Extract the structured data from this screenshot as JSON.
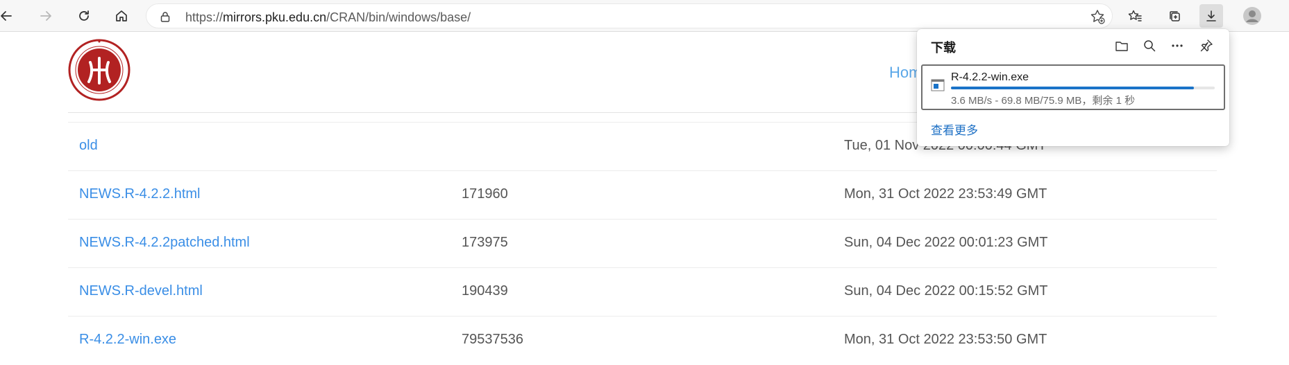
{
  "browser": {
    "url_prefix": "https://",
    "url_host": "mirrors.pku.edu.cn",
    "url_path": "/CRAN/bin/windows/base/"
  },
  "page": {
    "home_link": "Hom",
    "rows": [
      {
        "name": "old",
        "size": "",
        "date": "Tue, 01 Nov 2022 00:00:44 GMT"
      },
      {
        "name": "NEWS.R-4.2.2.html",
        "size": "171960",
        "date": "Mon, 31 Oct 2022 23:53:49 GMT"
      },
      {
        "name": "NEWS.R-4.2.2patched.html",
        "size": "173975",
        "date": "Sun, 04 Dec 2022 00:01:23 GMT"
      },
      {
        "name": "NEWS.R-devel.html",
        "size": "190439",
        "date": "Sun, 04 Dec 2022 00:15:52 GMT"
      },
      {
        "name": "R-4.2.2-win.exe",
        "size": "79537536",
        "date": "Mon, 31 Oct 2022 23:53:50 GMT"
      }
    ]
  },
  "downloads": {
    "title": "下载",
    "item": {
      "file_name": "R-4.2.2-win.exe",
      "status": "3.6 MB/s - 69.8 MB/75.9 MB，剩余 1 秒",
      "progress_fraction": 0.92
    },
    "see_more": "查看更多"
  },
  "icons": {
    "back": "back-arrow-icon",
    "forward": "forward-arrow-icon",
    "refresh": "refresh-icon",
    "home": "home-icon",
    "lock": "lock-icon",
    "add_favorite": "add-favorite-icon",
    "favorites": "favorites-icon",
    "collections": "collections-icon",
    "download": "download-icon",
    "profile": "profile-icon",
    "folder": "folder-icon",
    "search": "search-icon",
    "more": "more-icon",
    "pin": "pin-icon"
  },
  "colors": {
    "link": "#3a8ee6",
    "progress": "#1a73c8",
    "logo_red": "#b22222"
  }
}
